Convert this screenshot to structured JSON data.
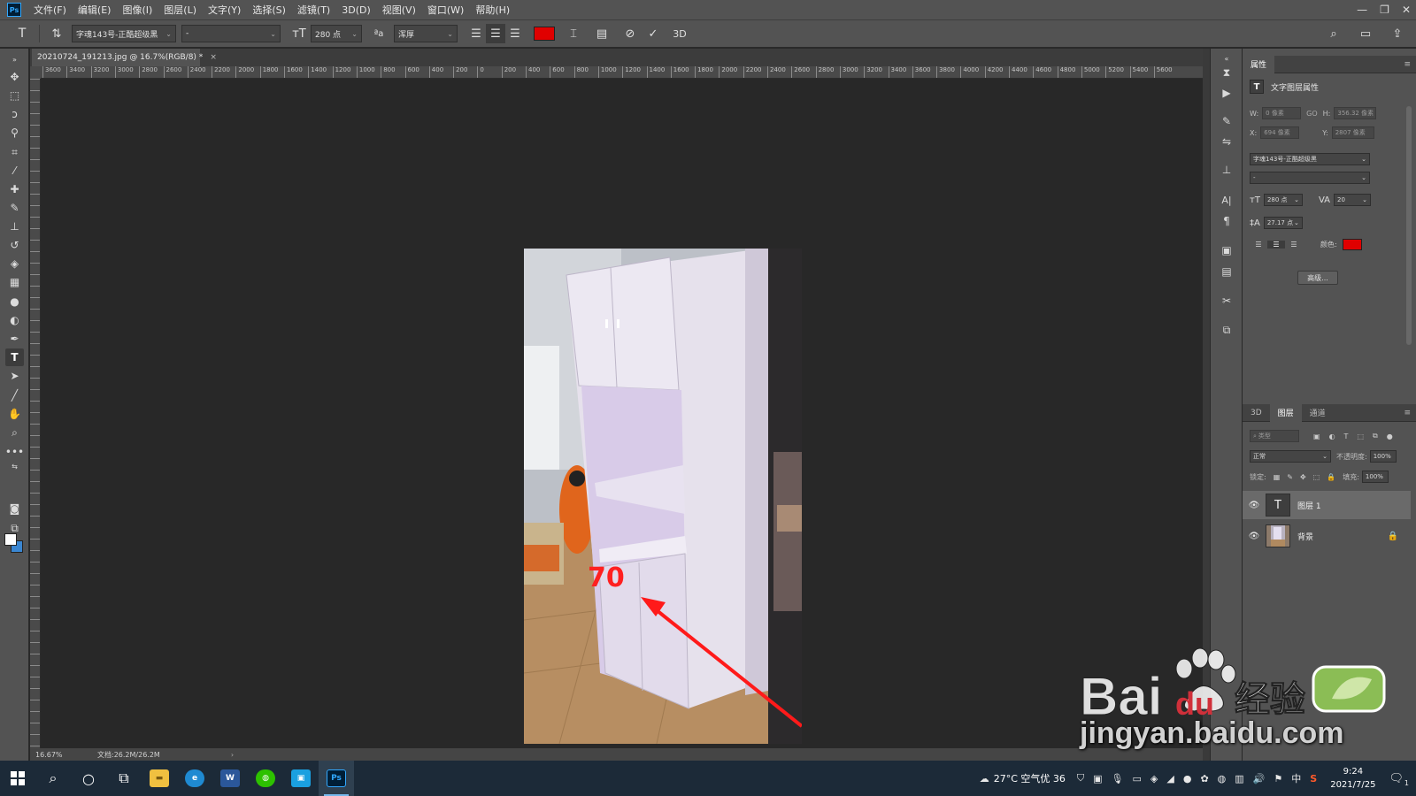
{
  "menubar": {
    "items": [
      "文件(F)",
      "编辑(E)",
      "图像(I)",
      "图层(L)",
      "文字(Y)",
      "选择(S)",
      "滤镜(T)",
      "3D(D)",
      "视图(V)",
      "窗口(W)",
      "帮助(H)"
    ]
  },
  "options": {
    "font_family": "字魂143号-正酷超级黑",
    "font_style": "-",
    "font_size": "280 点",
    "antialias": "浑厚",
    "text_color": "#e00000"
  },
  "document": {
    "tab_title": "20210724_191213.jpg @ 16.7%(RGB/8) *",
    "close_glyph": "×",
    "ruler_labels": [
      "3600",
      "3400",
      "3200",
      "3000",
      "2800",
      "2600",
      "2400",
      "2200",
      "2000",
      "1800",
      "1600",
      "1400",
      "1200",
      "1000",
      "800",
      "600",
      "400",
      "200",
      "0",
      "200",
      "400",
      "600",
      "800",
      "1000",
      "1200",
      "1400",
      "1600",
      "1800",
      "2000",
      "2200",
      "2400",
      "2600",
      "2800",
      "3000",
      "3200",
      "3400",
      "3600",
      "3800",
      "4000",
      "4200",
      "4400",
      "4600",
      "4800",
      "5000",
      "5200",
      "5400",
      "5600"
    ],
    "canvas_text": "70",
    "arrow_color": "#ff1a1a"
  },
  "status": {
    "zoom": "16.67%",
    "doc_size": "文档:26.2M/26.2M",
    "chevron": "›"
  },
  "properties": {
    "title": "属性",
    "subtitle": "文字图层属性",
    "w_label": "W:",
    "w_value": "0 像素",
    "h_label": "H:",
    "h_value": "356.32 像素",
    "x_label": "X:",
    "x_value": "694 像素",
    "y_label": "Y:",
    "y_value": "2807 像素",
    "link_glyph": "GO",
    "font_family": "字魂143号-正酷超级黑",
    "font_style": "-",
    "font_size": "280 点",
    "tracking": "20",
    "leading": "27.17 点",
    "color_label": "颜色:",
    "advanced_button": "高级..."
  },
  "layers_panel": {
    "tabs": [
      "3D",
      "图层",
      "通道"
    ],
    "filter_placeholder": "类型",
    "blend_mode": "正常",
    "opacity_label": "不透明度:",
    "opacity_value": "100%",
    "lock_label": "锁定:",
    "fill_label": "填充:",
    "fill_value": "100%",
    "layers": [
      {
        "name": "图层 1",
        "thumb": "T"
      },
      {
        "name": "背景",
        "thumb": ""
      }
    ]
  },
  "taskbar": {
    "weather": "27°C  空气优 36",
    "ime": "中",
    "time": "9:24",
    "date": "2021/7/25",
    "notif_count": "1"
  },
  "watermark": {
    "brand": "Bai",
    "brand2": "du",
    "cn": "经验",
    "url": "jingyan.baidu.com"
  }
}
